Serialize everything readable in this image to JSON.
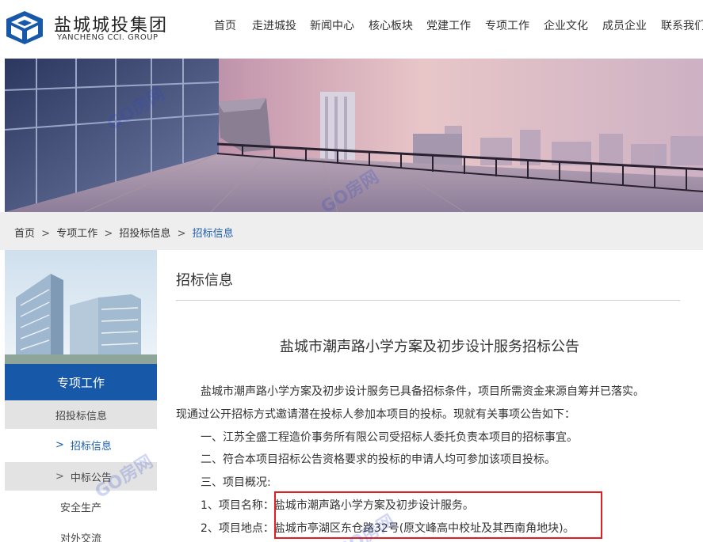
{
  "header": {
    "logo_cn": "盐城城投集团",
    "logo_en": "YANCHENG CCI. GROUP",
    "nav": [
      "首页",
      "走进城投",
      "新闻中心",
      "核心板块",
      "党建工作",
      "专项工作",
      "企业文化",
      "成员企业",
      "联系我们"
    ]
  },
  "breadcrumb": {
    "items": [
      "首页",
      "专项工作",
      "招投标信息"
    ],
    "current": "招标信息",
    "separator": ">"
  },
  "sidebar": {
    "title": "专项工作",
    "items": [
      {
        "label": "招投标信息"
      },
      {
        "label": "招标信息",
        "arrow": ">"
      },
      {
        "label": "中标公告",
        "arrow": ">"
      },
      {
        "label": "安全生产"
      },
      {
        "label": "对外交流"
      }
    ]
  },
  "content": {
    "section_title": "招标信息",
    "article_title": "盐城市潮声路小学方案及初步设计服务招标公告",
    "paragraphs": [
      "盐城市潮声路小学方案及初步设计服务已具备招标条件，项目所需资金来源自筹并已落实。",
      "现通过公开招标方式邀请潜在投标人参加本项目的投标。现就有关事项公告如下：",
      "一、江苏全盛工程造价事务所有限公司受招标人委托负责本项目的招标事宜。",
      "二、符合本项目招标公告资格要求的投标的申请人均可参加该项目投标。",
      "三、项目概况:",
      "1、项目名称：盐城市潮声路小学方案及初步设计服务。",
      "2、项目地点：盐城市亭湖区东仓路32号(原文峰高中校址及其西南角地块)。"
    ]
  },
  "watermark": "GO房网",
  "colors": {
    "brand_blue": "#1759a8",
    "link_blue": "#1f5fae",
    "highlight_red": "#e02020"
  }
}
